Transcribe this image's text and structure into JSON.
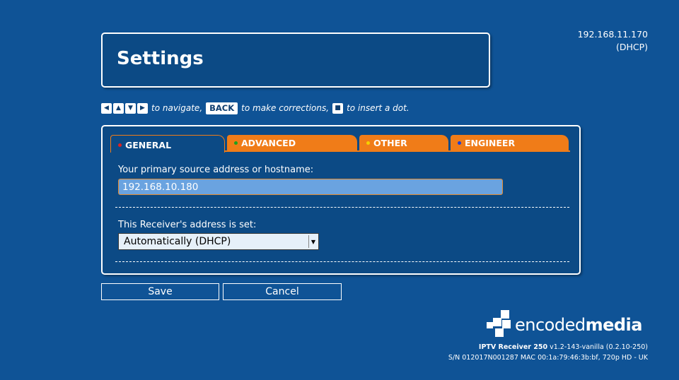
{
  "page": {
    "title": "Settings"
  },
  "network": {
    "ip": "192.168.11.170",
    "mode": "(DHCP)"
  },
  "hint": {
    "navigate": "to navigate,",
    "back_key": "BACK",
    "corrections": "to make corrections,",
    "dot": "to insert a dot."
  },
  "tabs": [
    {
      "label": "GENERAL",
      "dot_color": "#e02020"
    },
    {
      "label": "ADVANCED",
      "dot_color": "#1fa01f"
    },
    {
      "label": "OTHER",
      "dot_color": "#f5d000"
    },
    {
      "label": "ENGINEER",
      "dot_color": "#1a3fd8"
    }
  ],
  "form": {
    "source_label": "Your primary source address or hostname:",
    "source_value": "192.168.10.180",
    "address_label": "This Receiver's address is set:",
    "address_value": "Automatically (DHCP)"
  },
  "buttons": {
    "save": "Save",
    "cancel": "Cancel"
  },
  "brand": {
    "light": "encoded",
    "bold": "media"
  },
  "footer": {
    "product": "IPTV Receiver 250",
    "version": " v1.2-143-vanilla (0.2.10-250)",
    "serial": "S/N 012017N001287 MAC 00:1a:79:46:3b:bf, 720p HD - UK"
  },
  "colors": {
    "background": "#0f5396",
    "tab_accent": "#f07c18",
    "input_fill": "#6aa3e0"
  }
}
